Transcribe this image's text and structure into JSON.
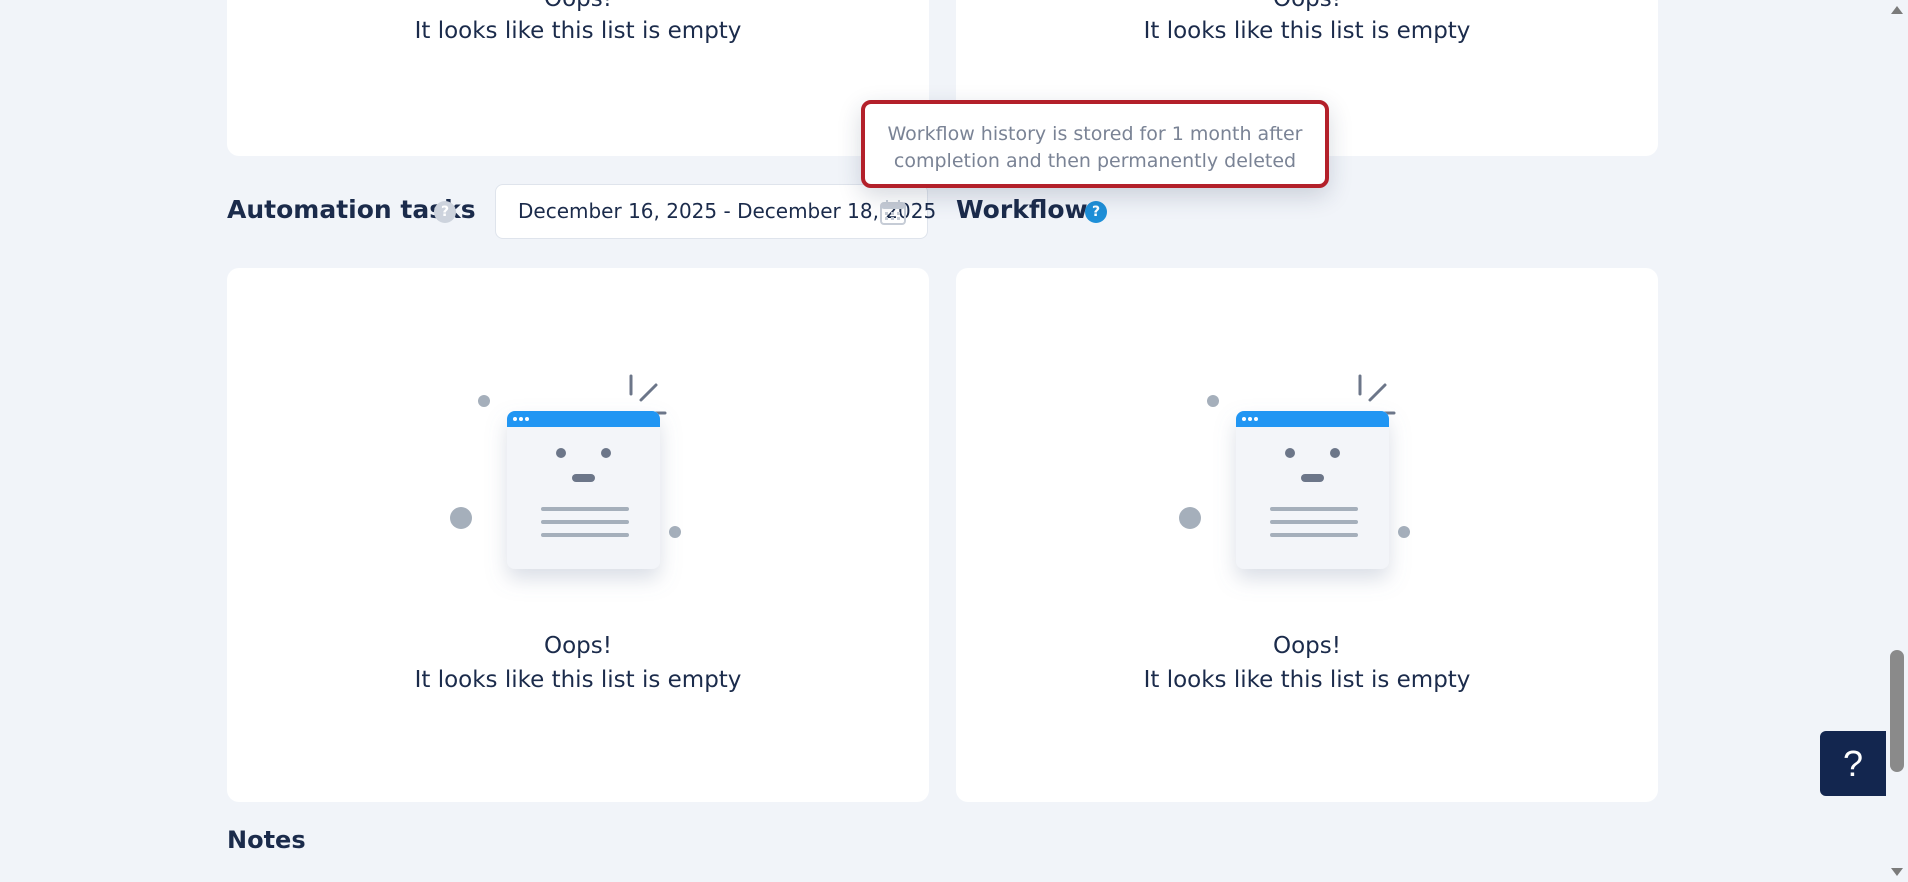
{
  "top_panels": {
    "left": {
      "title": "Oops!",
      "message": "It looks like this list is empty"
    },
    "right": {
      "title": "Oops!",
      "message": "It looks like this list is empty"
    }
  },
  "tooltip": {
    "line1": "Workflow history is stored for 1 month after",
    "line2": "completion and then permanently deleted"
  },
  "automation_tasks": {
    "title": "Automation tasks",
    "help_icon": "question-icon",
    "date_range": "December 16, 2025 - December 18, 2025",
    "date_icon": "calendar-icon",
    "empty_title": "Oops!",
    "empty_message": "It looks like this list is empty"
  },
  "workflows": {
    "title": "Workflows",
    "help_icon": "question-icon",
    "empty_title": "Oops!",
    "empty_message": "It looks like this list is empty"
  },
  "notes": {
    "title": "Notes"
  },
  "help_button": {
    "label": "?"
  },
  "colors": {
    "background": "#f1f4f9",
    "text": "#1b2b4b",
    "accent_blue": "#1e8fd8",
    "tooltip_border": "#b3202a",
    "help_button": "#13264f"
  }
}
